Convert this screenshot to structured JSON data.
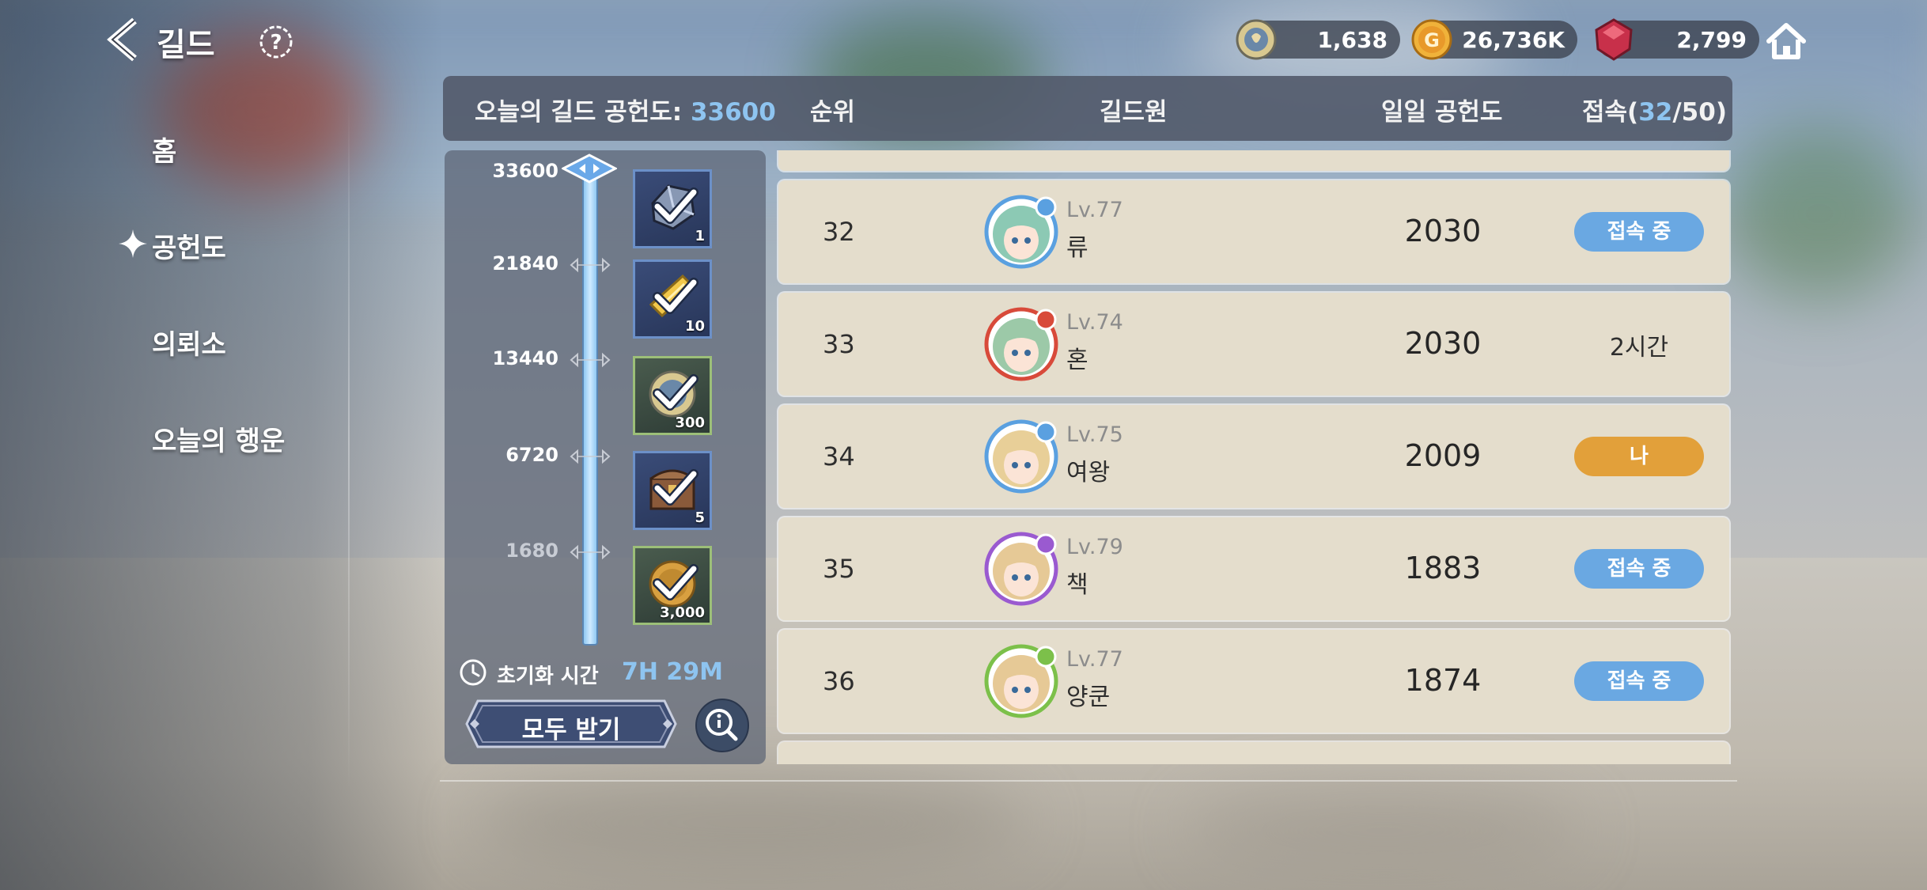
{
  "screen": {
    "title": "길드",
    "currencies": [
      {
        "name": "stamina",
        "value": "1,638",
        "color": "#c9b88a"
      },
      {
        "name": "gold",
        "value": "26,736K",
        "color": "#e8a22c"
      },
      {
        "name": "gem",
        "value": "2,799",
        "color": "#d03a50"
      }
    ]
  },
  "menu": {
    "items": [
      {
        "label": "홈",
        "active": false
      },
      {
        "label": "공헌도",
        "active": true
      },
      {
        "label": "의뢰소",
        "active": false
      },
      {
        "label": "오늘의 행운",
        "active": false
      }
    ]
  },
  "header": {
    "today_label": "오늘의 길드 공헌도:",
    "today_value": "33600",
    "col_rank": "순위",
    "col_member": "길드원",
    "col_daily": "일일 공헌도",
    "col_access_label": "접속(",
    "col_access_online": "32",
    "col_access_rest": "/50)"
  },
  "rewards": {
    "milestones": [
      {
        "value": "33600",
        "reached": true,
        "qty": "1",
        "item": "crystal-ore"
      },
      {
        "value": "21840",
        "reached": true,
        "qty": "10",
        "item": "gold-ticket"
      },
      {
        "value": "13440",
        "reached": true,
        "qty": "300",
        "item": "stamina-orb"
      },
      {
        "value": "6720",
        "reached": true,
        "qty": "5",
        "item": "treasure-chest"
      },
      {
        "value": "1680",
        "reached": true,
        "qty": "3,000",
        "item": "gold-coin"
      }
    ],
    "progress": 1.0,
    "reset_label": "초기화 시간",
    "reset_time": "7H 29M",
    "claim_all": "모두 받기"
  },
  "members": [
    {
      "rank": "32",
      "level": "Lv.77",
      "name": "류",
      "points": "2030",
      "status": "접속 중",
      "status_type": "online",
      "element": "water",
      "hair": "#8cc9b4"
    },
    {
      "rank": "33",
      "level": "Lv.74",
      "name": "혼",
      "points": "2030",
      "status": "2시간",
      "status_type": "offline",
      "element": "fire",
      "hair": "#9cc9a8"
    },
    {
      "rank": "34",
      "level": "Lv.75",
      "name": "여왕",
      "points": "2009",
      "status": "나",
      "status_type": "me",
      "element": "water",
      "hair": "#e8cf98"
    },
    {
      "rank": "35",
      "level": "Lv.79",
      "name": "책",
      "points": "1883",
      "status": "접속 중",
      "status_type": "online",
      "element": "dark",
      "hair": "#e6c996"
    },
    {
      "rank": "36",
      "level": "Lv.77",
      "name": "양쿤",
      "points": "1874",
      "status": "접속 중",
      "status_type": "online",
      "element": "nature",
      "hair": "#e6c996"
    }
  ]
}
